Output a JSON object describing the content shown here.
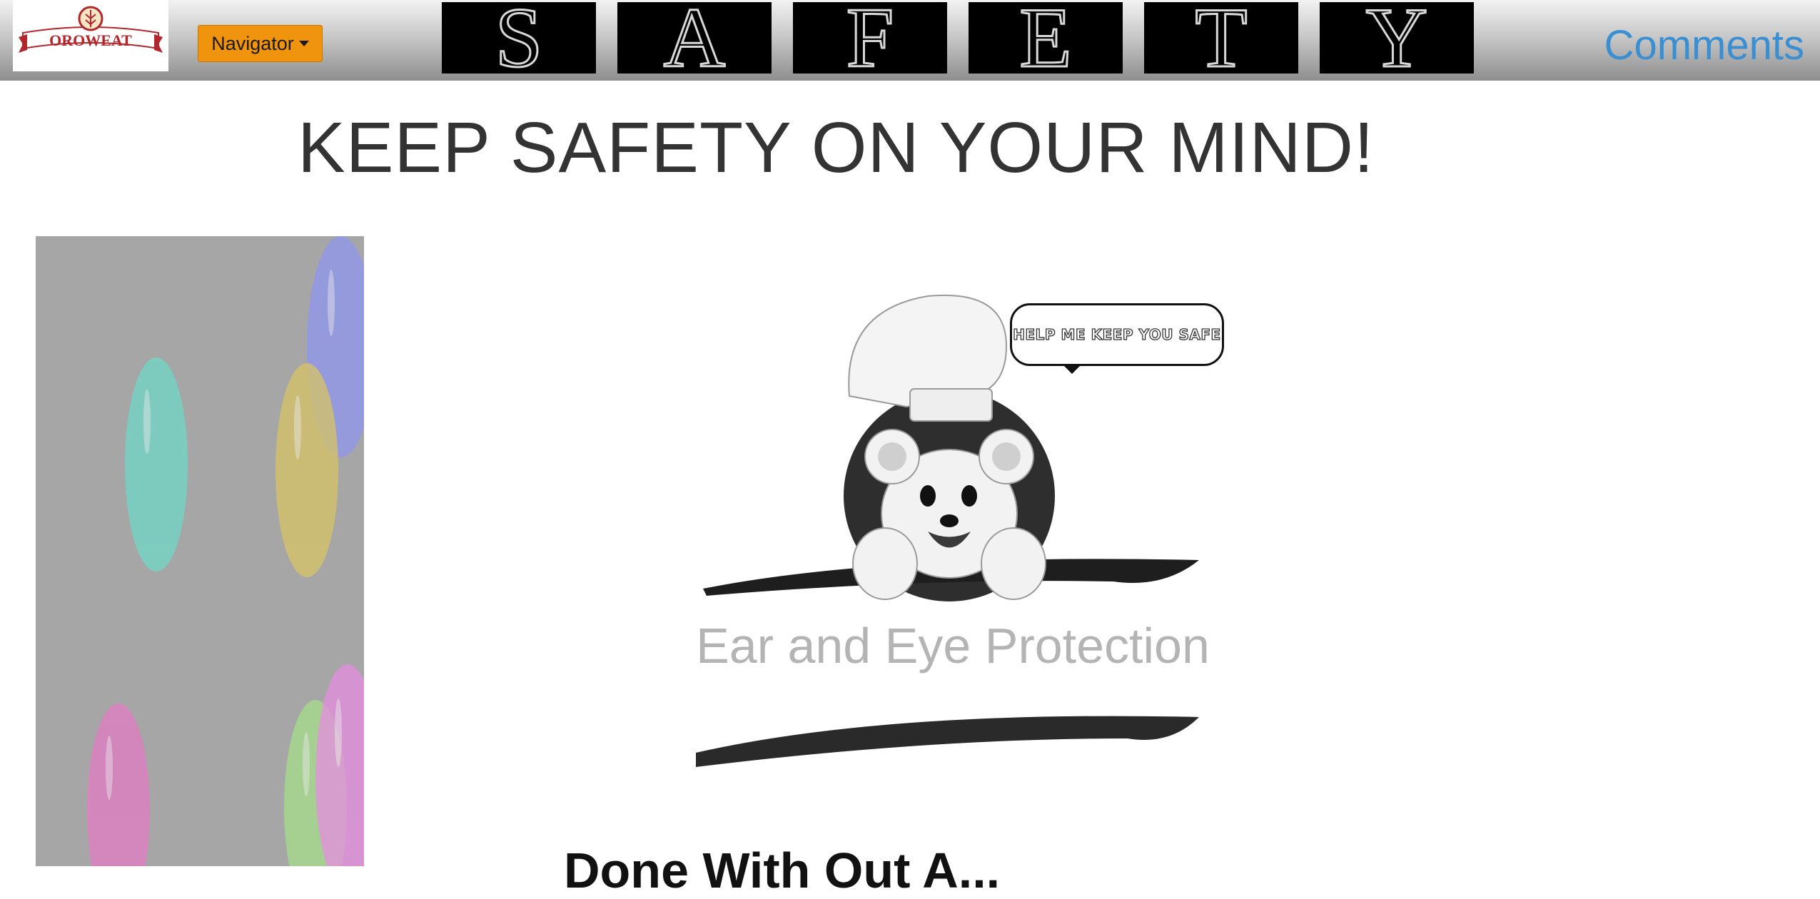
{
  "header": {
    "logo_text": "OROWEAT",
    "navigator_label": "Navigator",
    "banner_letters": [
      "S",
      "A",
      "F",
      "E",
      "T",
      "Y"
    ],
    "comments_label": "Comments"
  },
  "main": {
    "title": "KEEP SAFETY ON YOUR MIND!",
    "speech_bubble": "HELP ME KEEP YOU SAFE",
    "caption": "Ear and Eye Protection",
    "section_heading_partial": "Done With Out A..."
  },
  "icons": {
    "logo": "oroweat-logo-icon",
    "navigator_caret": "caret-down-icon",
    "mascot": "bear-chef-mascot-icon",
    "balloons": "balloon-icon"
  },
  "colors": {
    "navigator_button": "#f0940e",
    "comments_link": "#3a8fd2",
    "side_panel": "#a6a6a6",
    "caption_text": "#b4b4b4",
    "banner_tile": "#000000"
  }
}
